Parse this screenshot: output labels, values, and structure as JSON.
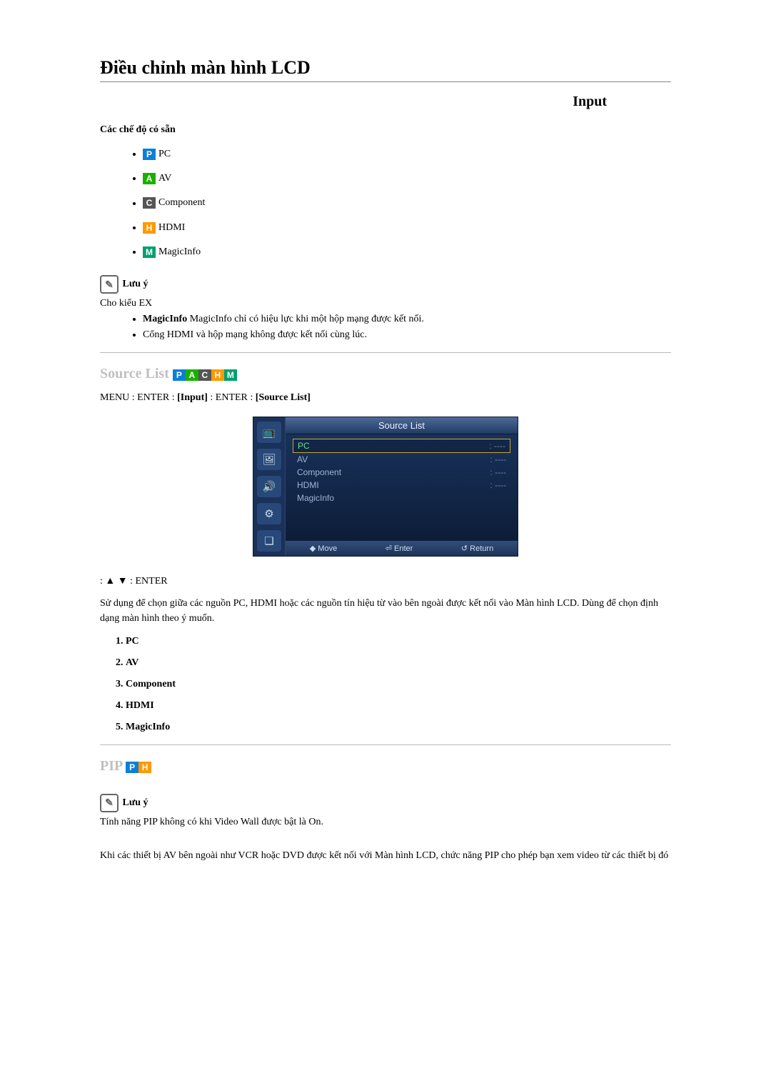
{
  "page_title": "Điều chỉnh màn hình LCD",
  "input_label": "Input",
  "modes": {
    "subhead": "Các chế độ có sẵn",
    "items": [
      {
        "badge": "P",
        "label": "PC",
        "cls": "badge-p"
      },
      {
        "badge": "A",
        "label": "AV",
        "cls": "badge-a"
      },
      {
        "badge": "C",
        "label": "Component",
        "cls": "badge-c"
      },
      {
        "badge": "H",
        "label": "HDMI",
        "cls": "badge-h"
      },
      {
        "badge": "M",
        "label": "MagicInfo",
        "cls": "badge-m"
      }
    ]
  },
  "note1": {
    "label": "Lưu ý",
    "line1": "Cho kiểu EX",
    "bullets": [
      "MagicInfo chỉ có hiệu lực khi một hộp mạng được kết nối.",
      "Cổng HDMI và hộp mạng không được kết nối cùng lúc."
    ]
  },
  "source_list": {
    "heading": "Source List",
    "menu_line": "MENU  : ENTER   :",
    "menu_input": "[Input]",
    "menu_mid": " : ENTER   : ",
    "menu_source": "[Source List]",
    "osd_title": "Source List",
    "rows": [
      {
        "name": "PC",
        "val": ": ----",
        "selected": true
      },
      {
        "name": "AV",
        "val": ": ----",
        "selected": false
      },
      {
        "name": "Component",
        "val": ": ----",
        "selected": false
      },
      {
        "name": "HDMI",
        "val": ": ----",
        "selected": false
      },
      {
        "name": "MagicInfo",
        "val": "",
        "selected": false
      }
    ],
    "footer": {
      "move": "◆ Move",
      "enter": "⏎ Enter",
      "return": "↺ Return"
    },
    "nav_line": " :  ▲  ▼  : ENTER",
    "desc": "Sử dụng để chọn giữa các nguồn PC, HDMI hoặc các nguồn tín hiệu từ vào bên ngoài được kết nối vào Màn hình LCD. Dùng để chọn định dạng màn hình theo ý muốn.",
    "numlist": [
      "PC",
      "AV",
      "Component",
      "HDMI",
      "MagicInfo"
    ]
  },
  "pip": {
    "heading": "PIP",
    "note_label": "Lưu ý",
    "note_text": "Tính năng PIP không có khi Video Wall được bật là On.",
    "body": "Khi các thiết bị AV bên ngoài như VCR hoặc DVD được kết nối với Màn hình LCD, chức năng PIP cho phép bạn xem video từ các thiết bị đó"
  }
}
